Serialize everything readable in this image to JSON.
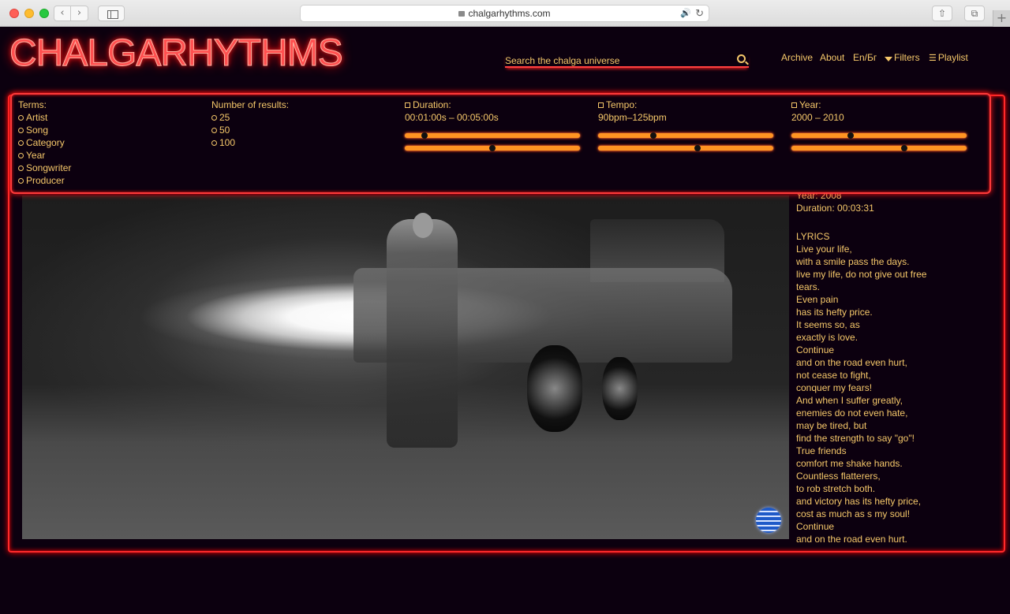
{
  "browser": {
    "url": "chalgarhythms.com",
    "back_icon": "‹",
    "forward_icon": "›",
    "speaker_icon": "🔊",
    "reload_icon": "↻",
    "share_icon": "⇧",
    "tabs_icon": "⧉",
    "new_tab_icon": "+"
  },
  "header": {
    "logo": "CHALGARHYTHMS",
    "search_placeholder": "Search the chalga universe",
    "nav": {
      "archive": "Archive",
      "about": "About",
      "language": "En/Бг",
      "filters": "Filters",
      "playlist": "Playlist"
    }
  },
  "filters": {
    "terms": {
      "label": "Terms:",
      "options": [
        "Artist",
        "Song",
        "Category",
        "Year",
        "Songwriter",
        "Producer"
      ]
    },
    "results": {
      "label": "Number of results:",
      "options": [
        "25",
        "50",
        "100"
      ]
    },
    "duration": {
      "label": "Duration:",
      "range": "00:01:00s – 00:05:00s",
      "low": 0.1,
      "high": 0.5
    },
    "tempo": {
      "label": "Tempo:",
      "range": "90bpm–125bpm",
      "low": 0.31,
      "high": 0.57
    },
    "year": {
      "label": "Year:",
      "range": "2000 – 2010",
      "low": 0.33,
      "high": 0.65
    }
  },
  "song": {
    "year": "Year: 2008",
    "duration": "Duration: 00:03:31",
    "lyrics_title": "LYRICS",
    "lyrics": [
      "Live your life,",
      "with a smile pass the days.",
      "live my life, do not give out free",
      "tears.",
      "Even pain",
      "has its hefty price.",
      "It seems so, as",
      "exactly is love.",
      "Continue",
      "and on the road even hurt,",
      "not cease to fight,",
      "conquer my fears!",
      "And when I suffer greatly,",
      "enemies do not even hate,",
      "may be tired, but",
      "find the strength to say \"go\"!",
      "True friends",
      "comfort me shake hands.",
      "Countless flatterers,",
      "to rob stretch both.",
      "and victory has its hefty price,",
      "cost as much as s my soul!",
      "Continue",
      "and on the road even hurt."
    ]
  },
  "colors": {
    "neon_red": "#ff2a2a",
    "text_amber": "#f5c76a",
    "slider_orange": "#ff9422",
    "background": "#0c000f"
  }
}
